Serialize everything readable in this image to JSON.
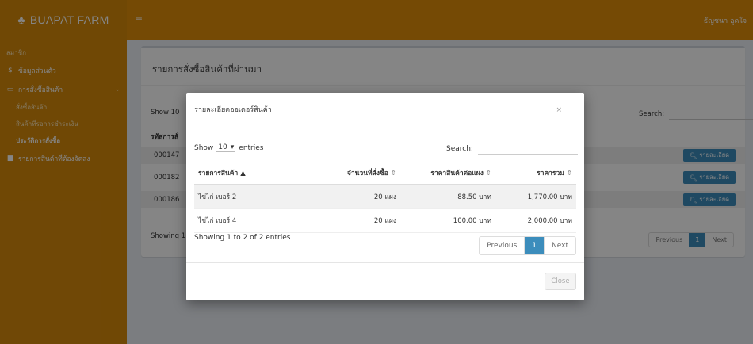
{
  "app": {
    "brand": "BUAPAT FARM",
    "user_name": "ธัญชนา อุดใจ"
  },
  "sidebar": {
    "header": "สมาชิก",
    "items": [
      {
        "label": "ข้อมูลส่วนตัว",
        "icon": "dollar-icon"
      },
      {
        "label": "การสั่งซื้อสินค้า",
        "icon": "folder-open-icon"
      },
      {
        "label": "รายการสินค้าที่ต้องจัดส่ง",
        "icon": "truck-icon"
      }
    ],
    "subitems": [
      "สั่งซื้อสินค้า",
      "สินค้าที่รอการชำระเงิน",
      "ประวัติการสั่งซื้อ"
    ]
  },
  "page": {
    "title": "รายการสั่งซื้อสินค้าที่ผ่านมา",
    "show_label": "Show 10",
    "search_label": "Search:",
    "col_code": "รหัสการสั่",
    "rows": [
      "000147",
      "000182",
      "000186"
    ],
    "detail_label": "รายละเอียด",
    "showing": "Showing 1",
    "prev": "Previous",
    "page": "1",
    "next": "Next"
  },
  "modal": {
    "title": "รายละเอียดออเดอร์สินค้า",
    "close_x": "×",
    "show": "Show",
    "show_value": "10",
    "entries": "entries",
    "search_label": "Search:",
    "columns": [
      "รายการสินค้า",
      "จำนวนที่สั่งซื้อ",
      "ราคาสินค้าต่อแผง",
      "ราคารวม"
    ],
    "rows": [
      [
        "ไข่ไก่ เบอร์ 2",
        "20 แผง",
        "88.50 บาท",
        "1,770.00 บาท"
      ],
      [
        "ไข่ไก่ เบอร์ 4",
        "20 แผง",
        "100.00 บาท",
        "2,000.00 บาท"
      ]
    ],
    "info": "Showing 1 to 2 of 2 entries",
    "prev": "Previous",
    "page": "1",
    "next": "Next",
    "close_label": "Close"
  }
}
